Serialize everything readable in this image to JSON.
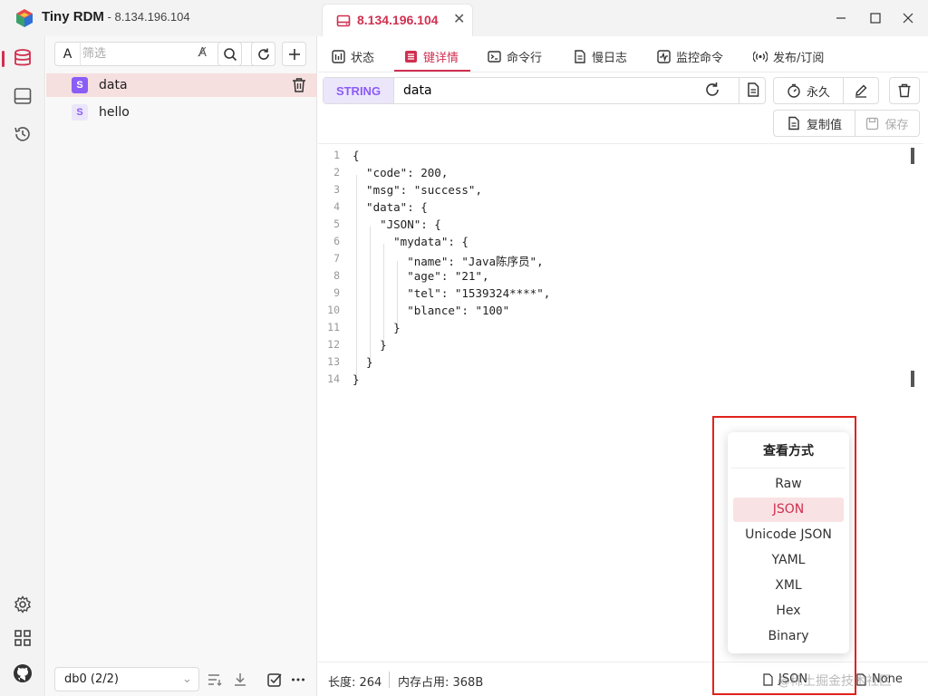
{
  "app": {
    "title": "Tiny RDM",
    "host_separator": " - ",
    "host": "8.134.196.104"
  },
  "connection_tab": {
    "name": "8.134.196.104"
  },
  "key_panel": {
    "filter_label": "A",
    "filter_placeholder": "筛选",
    "keys": [
      {
        "type": "S",
        "name": "data",
        "selected": true
      },
      {
        "type": "S",
        "name": "hello",
        "selected": false
      }
    ],
    "db_select": "db0 (2/2)"
  },
  "tabs": [
    {
      "label": "状态",
      "icon": "info-icon"
    },
    {
      "label": "键详情",
      "icon": "detail-icon",
      "active": true
    },
    {
      "label": "命令行",
      "icon": "terminal-icon"
    },
    {
      "label": "慢日志",
      "icon": "log-icon"
    },
    {
      "label": "监控命令",
      "icon": "monitor-icon"
    },
    {
      "label": "发布/订阅",
      "icon": "broadcast-icon"
    }
  ],
  "key_detail": {
    "type": "STRING",
    "key": "data",
    "ttl_label": "永久",
    "copy_label": "复制值",
    "save_label": "保存"
  },
  "editor": {
    "line_numbers": [
      "1",
      "2",
      "3",
      "4",
      "5",
      "6",
      "7",
      "8",
      "9",
      "10",
      "11",
      "12",
      "13",
      "14"
    ],
    "lines": [
      "{",
      "  \"code\": 200,",
      "  \"msg\": \"success\",",
      "  \"data\": {",
      "    \"JSON\": {",
      "      \"mydata\": {",
      "        \"name\": \"Java陈序员\",",
      "        \"age\": \"21\",",
      "        \"tel\": \"1539324****\",",
      "        \"blance\": \"100\"",
      "      }",
      "    }",
      "  }",
      "}"
    ]
  },
  "status": {
    "length": "长度: 264",
    "memory": "内存占用: 368B",
    "view_mode": "JSON",
    "decode": "None"
  },
  "view_menu": {
    "title": "查看方式",
    "items": [
      "Raw",
      "JSON",
      "Unicode JSON",
      "YAML",
      "XML",
      "Hex",
      "Binary"
    ],
    "selected": "JSON"
  },
  "watermark": "@稀土掘金技术社区",
  "colors": {
    "accent": "#d03050",
    "string_type": "#8b5cf6",
    "highlight_box": "#e0231d"
  }
}
